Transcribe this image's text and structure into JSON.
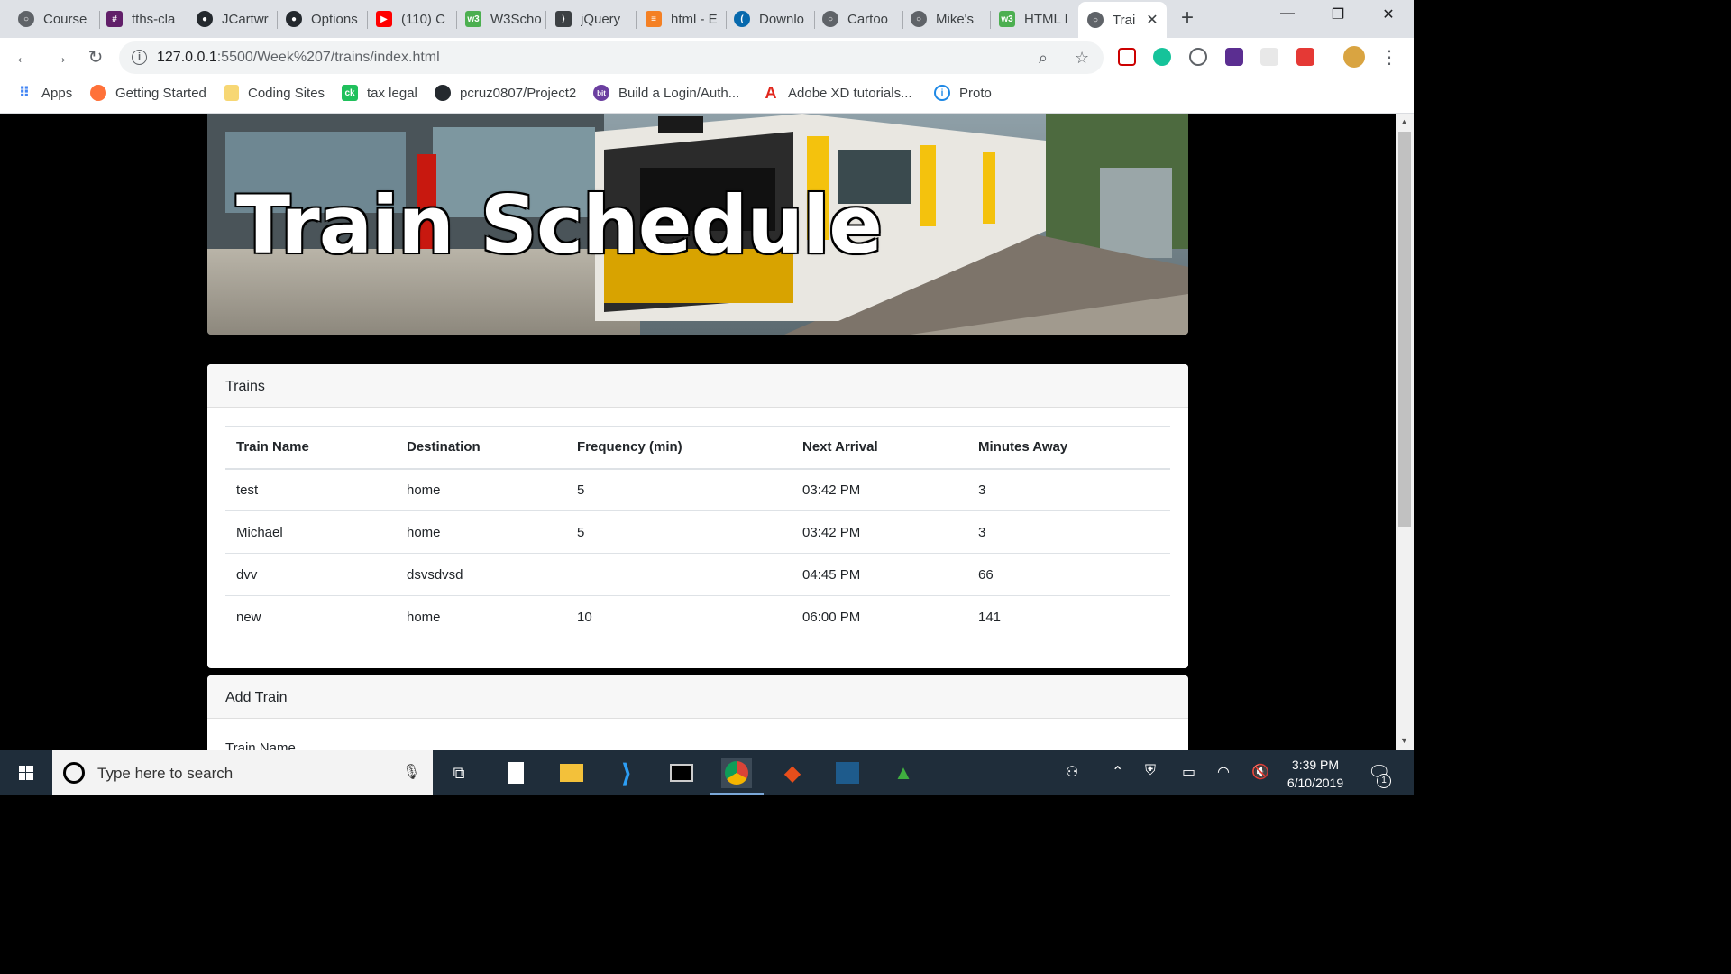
{
  "browser": {
    "tabs": [
      {
        "label": "Course"
      },
      {
        "label": "tths-cla"
      },
      {
        "label": "JCartwr"
      },
      {
        "label": "Options"
      },
      {
        "label": "(110) C"
      },
      {
        "label": "W3Scho"
      },
      {
        "label": "jQuery"
      },
      {
        "label": "html - E"
      },
      {
        "label": "Downlo"
      },
      {
        "label": "Cartoo"
      },
      {
        "label": "Mike's"
      },
      {
        "label": "HTML I"
      },
      {
        "label": "Trai"
      }
    ],
    "new_tab": "+",
    "url_host": "127.0.0.1",
    "url_rest": ":5500/Week%207/trains/index.html",
    "bookmarks": [
      {
        "label": "Apps"
      },
      {
        "label": "Getting Started"
      },
      {
        "label": "Coding Sites"
      },
      {
        "label": "tax legal"
      },
      {
        "label": "pcruz0807/Project2"
      },
      {
        "label": "Build a Login/Auth..."
      },
      {
        "label": "Adobe XD tutorials..."
      },
      {
        "label": "Proto"
      }
    ]
  },
  "page": {
    "hero_title": "Train Schedule",
    "trains_card": {
      "header": "Trains",
      "columns": [
        "Train Name",
        "Destination",
        "Frequency (min)",
        "Next Arrival",
        "Minutes Away"
      ],
      "rows": [
        [
          "test",
          "home",
          "5",
          "03:42 PM",
          "3"
        ],
        [
          "Michael",
          "home",
          "5",
          "03:42 PM",
          "3"
        ],
        [
          "dvv",
          "dsvsdvsd",
          "",
          "04:45 PM",
          "66"
        ],
        [
          "new",
          "home",
          "10",
          "06:00 PM",
          "141"
        ]
      ]
    },
    "add_card": {
      "header": "Add Train",
      "first_label": "Train Name"
    }
  },
  "taskbar": {
    "search_placeholder": "Type here to search",
    "time": "3:39 PM",
    "date": "6/10/2019",
    "notification_count": "1"
  }
}
